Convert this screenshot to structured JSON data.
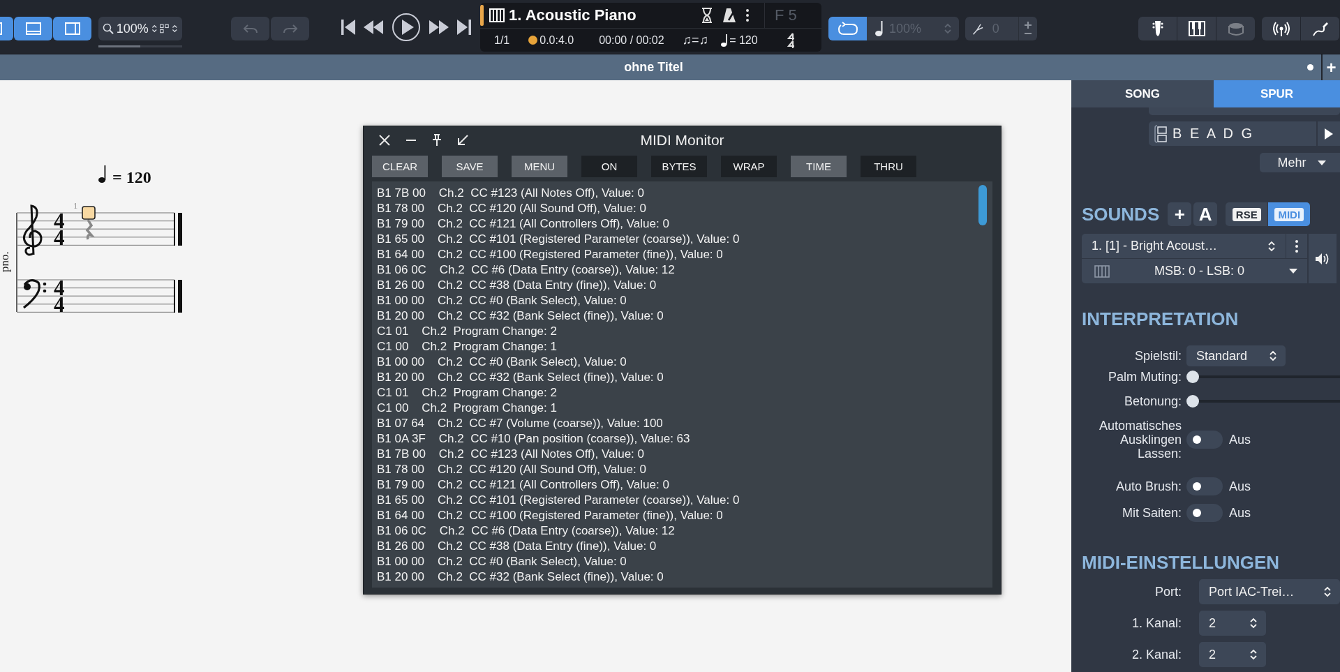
{
  "toolbar": {
    "view_buttons": [
      {
        "selected": true
      },
      {
        "selected": true
      },
      {
        "selected": true
      }
    ],
    "zoom_value": "100%",
    "undo": {
      "disabled": true
    },
    "redo": {
      "disabled": true
    },
    "track": {
      "title": "1. Acoustic Piano",
      "bar": "1/1",
      "position": "0.0:4.0",
      "time": "00:00 / 00:02",
      "swing": "♫=♫",
      "tempo": "= 120",
      "key": "F 5"
    },
    "loop": {
      "on": true
    },
    "speed": {
      "value": "100%",
      "disabled": true
    },
    "transpose": {
      "value": "0"
    },
    "views": [
      {
        "kind": "guitar",
        "disabled": false
      },
      {
        "kind": "piano",
        "disabled": false
      },
      {
        "kind": "drum",
        "disabled": true
      },
      {
        "kind": "wireless",
        "disabled": false
      },
      {
        "kind": "cable",
        "disabled": false
      }
    ]
  },
  "document": {
    "title": "ohne Titel",
    "modified": true,
    "add": "+"
  },
  "score": {
    "tempo": "= 120",
    "instrument": "pno.",
    "measure_number": "1",
    "staves": [
      {
        "kind": "treble",
        "time_signature": [
          "4",
          "4"
        ]
      },
      {
        "kind": "bass",
        "time_signature": [
          "4",
          "4"
        ]
      }
    ]
  },
  "midi_monitor": {
    "title": "MIDI Monitor",
    "buttons": [
      {
        "label": "CLEAR",
        "kind": "action"
      },
      {
        "label": "SAVE",
        "kind": "action"
      },
      {
        "label": "MENU",
        "kind": "action"
      },
      {
        "label": "ON",
        "kind": "toggle",
        "on": false
      },
      {
        "label": "BYTES",
        "kind": "toggle",
        "on": false
      },
      {
        "label": "WRAP",
        "kind": "toggle",
        "on": false
      },
      {
        "label": "TIME",
        "kind": "toggle",
        "on": true
      },
      {
        "label": "THRU",
        "kind": "toggle",
        "on": false
      }
    ],
    "lines": [
      "B1 7B 00    Ch.2  CC #123 (All Notes Off), Value: 0",
      "B1 78 00    Ch.2  CC #120 (All Sound Off), Value: 0",
      "B1 79 00    Ch.2  CC #121 (All Controllers Off), Value: 0",
      "B1 65 00    Ch.2  CC #101 (Registered Parameter (coarse)), Value: 0",
      "B1 64 00    Ch.2  CC #100 (Registered Parameter (fine)), Value: 0",
      "B1 06 0C    Ch.2  CC #6 (Data Entry (coarse)), Value: 12",
      "B1 26 00    Ch.2  CC #38 (Data Entry (fine)), Value: 0",
      "B1 00 00    Ch.2  CC #0 (Bank Select), Value: 0",
      "B1 20 00    Ch.2  CC #32 (Bank Select (fine)), Value: 0",
      "C1 01    Ch.2  Program Change: 2",
      "C1 00    Ch.2  Program Change: 1",
      "B1 00 00    Ch.2  CC #0 (Bank Select), Value: 0",
      "B1 20 00    Ch.2  CC #32 (Bank Select (fine)), Value: 0",
      "C1 01    Ch.2  Program Change: 2",
      "C1 00    Ch.2  Program Change: 1",
      "B1 07 64    Ch.2  CC #7 (Volume (coarse)), Value: 100",
      "B1 0A 3F    Ch.2  CC #10 (Pan position (coarse)), Value: 63",
      "B1 7B 00    Ch.2  CC #123 (All Notes Off), Value: 0",
      "B1 78 00    Ch.2  CC #120 (All Sound Off), Value: 0",
      "B1 79 00    Ch.2  CC #121 (All Controllers Off), Value: 0",
      "B1 65 00    Ch.2  CC #101 (Registered Parameter (coarse)), Value: 0",
      "B1 64 00    Ch.2  CC #100 (Registered Parameter (fine)), Value: 0",
      "B1 06 0C    Ch.2  CC #6 (Data Entry (coarse)), Value: 12",
      "B1 26 00    Ch.2  CC #38 (Data Entry (fine)), Value: 0",
      "B1 00 00    Ch.2  CC #0 (Bank Select), Value: 0",
      "B1 20 00    Ch.2  CC #32 (Bank Select (fine)), Value: 0"
    ]
  },
  "panel": {
    "tabs": [
      {
        "label": "SONG",
        "selected": false
      },
      {
        "label": "SPUR",
        "selected": true
      }
    ],
    "tuning": "B E A D G",
    "more": "Mehr",
    "sounds": {
      "title": "SOUNDS",
      "add": "+",
      "auto": "A",
      "engines": [
        {
          "label": "RSE",
          "selected": false
        },
        {
          "label": "MIDI",
          "selected": true
        }
      ],
      "sound": "1. [1] - Bright Acoust…",
      "bank": "MSB: 0 - LSB: 0"
    },
    "interpretation": {
      "title": "INTERPRETATION",
      "style": {
        "label": "Spielstil:",
        "value": "Standard"
      },
      "sliders": [
        {
          "label": "Palm Muting:",
          "level": 0
        },
        {
          "label": "Betonung:",
          "level": 0
        }
      ],
      "switches": [
        {
          "label": "Automatisches Ausklingen Lassen:",
          "on": false,
          "state": "Aus"
        },
        {
          "label": "Auto Brush:",
          "on": false,
          "state": "Aus"
        },
        {
          "label": "Mit Saiten:",
          "on": false,
          "state": "Aus"
        }
      ]
    },
    "midi": {
      "title": "MIDI-EINSTELLUNGEN",
      "selects": [
        {
          "label": "Port:",
          "value": "Port IAC-Trei…"
        },
        {
          "label": "1. Kanal:",
          "value": "2"
        },
        {
          "label": "2. Kanal:",
          "value": "2"
        }
      ]
    }
  }
}
